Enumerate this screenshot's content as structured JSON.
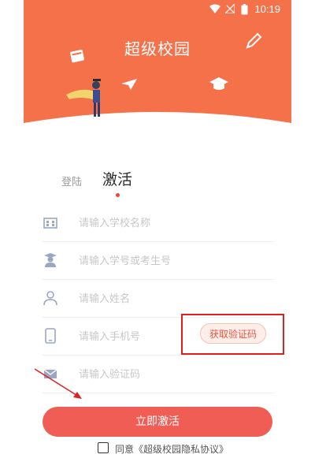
{
  "status_bar": {
    "time": "10:19"
  },
  "app_title": "超级校园",
  "tabs": [
    {
      "label": "登陆"
    },
    {
      "label": "激活"
    }
  ],
  "form": {
    "fields": [
      {
        "placeholder": "请输入学校名称",
        "icon": "school-building-icon"
      },
      {
        "placeholder": "请输入学号或考生号",
        "icon": "student-icon"
      },
      {
        "placeholder": "请输入姓名",
        "icon": "person-icon"
      },
      {
        "placeholder": "请输入手机号",
        "icon": "phone-icon"
      },
      {
        "placeholder": "请输入验证码",
        "icon": "envelope-icon"
      }
    ],
    "get_code_label": "获取验证码",
    "submit_label": "立即激活",
    "agreement_label": "同意《超级校园隐私协议》"
  },
  "colors": {
    "header": "#f4714a",
    "button": "#f05d55",
    "highlight": "#e02020"
  }
}
